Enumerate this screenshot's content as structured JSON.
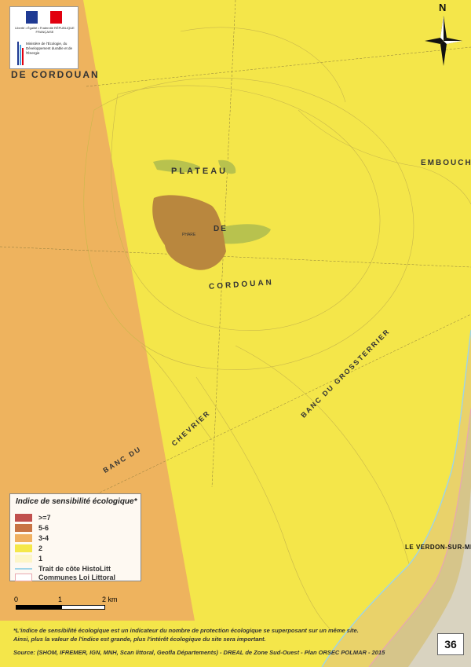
{
  "header_logo": {
    "republic": "Liberté • Égalité • Fraternité RÉPUBLIQUE FRANÇAISE",
    "ministry": "Ministère de l'Écologie, du Développement durable et de l'Énergie",
    "flag_colors": [
      "#1f3a93",
      "#ffffff",
      "#e1000f"
    ]
  },
  "north_arrow": {
    "label": "N"
  },
  "place_names": {
    "de_cordouan": "DE CORDOUAN",
    "plateau": "PLATEAU",
    "de": "DE",
    "cordouan": "CORDOUAN",
    "banc_grossterrier": "BANC DU GROSSTERRIER",
    "banc_du": "BANC DU",
    "chevrier": "CHEVRIER",
    "embouch": "EMBOUCH",
    "le_verdon": "LE VERDON-SUR-ME",
    "phare": "PHARE"
  },
  "legend": {
    "title": "Indice de sensibilité écologique*",
    "items": [
      {
        "label": ">=7",
        "color": "#c0504d"
      },
      {
        "label": "5-6",
        "color": "#c87444"
      },
      {
        "label": "3-4",
        "color": "#f0b060"
      },
      {
        "label": "2",
        "color": "#f5e84a"
      },
      {
        "label": "1",
        "color": "#fdf6c8"
      },
      {
        "label": "Trait de côte HistoLitt",
        "color": "#9ed4e8"
      },
      {
        "label": "Communes Loi Littoral",
        "color": "#e8a8b0"
      }
    ]
  },
  "scale": {
    "ticks": [
      "0",
      "1",
      "2 km"
    ]
  },
  "footer": {
    "note_line1": "*L'indice de sensibilité écologique est un indicateur du nombre de protection écologique se superposant sur un même site.",
    "note_line2": "Ainsi, plus la valeur de l'indice est grande, plus l'intérêt écologique du site sera important.",
    "source": "Source: (SHOM, IFREMER, IGN, MNH, Scan littoral, Geofla Départements) - DREAL de Zone Sud-Ouest - Plan ORSEC POLMAR - 2015"
  },
  "page_number": "36"
}
